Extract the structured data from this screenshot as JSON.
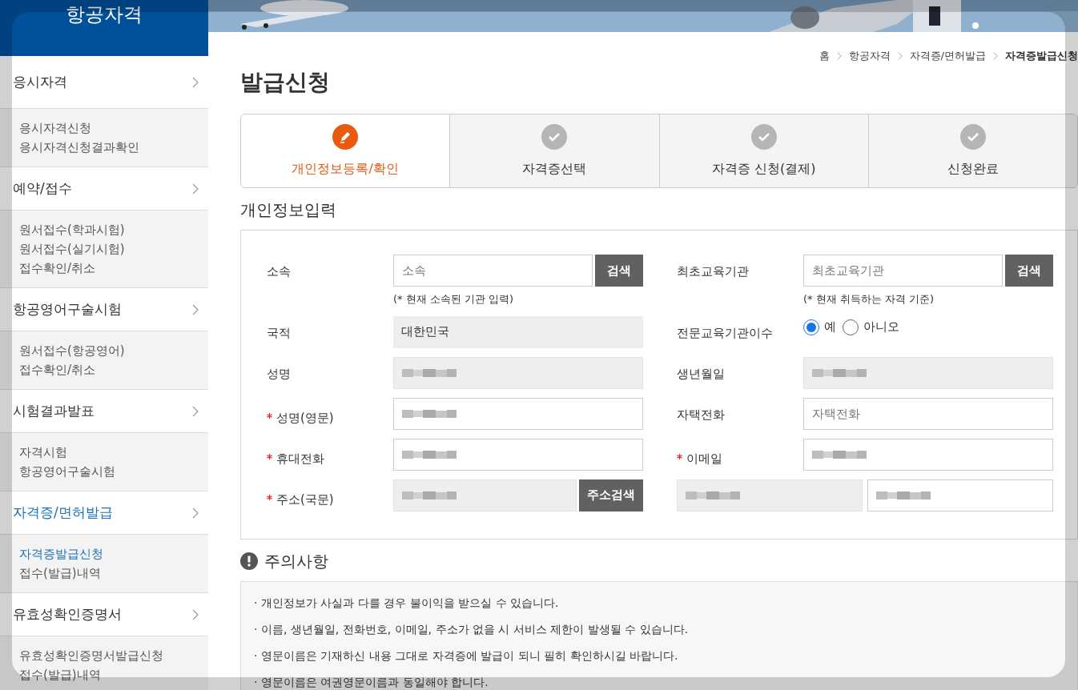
{
  "sidebar": {
    "title": "항공자격",
    "groups": [
      {
        "title": "응시자격",
        "selected": false,
        "items": [
          {
            "label": "응시자격신청",
            "selected": false
          },
          {
            "label": "응시자격신청결과확인",
            "selected": false
          }
        ]
      },
      {
        "title": "예약/접수",
        "selected": false,
        "items": [
          {
            "label": "원서접수(학과시험)",
            "selected": false
          },
          {
            "label": "원서접수(실기시험)",
            "selected": false
          },
          {
            "label": "접수확인/취소",
            "selected": false
          }
        ]
      },
      {
        "title": "항공영어구술시험",
        "selected": false,
        "items": [
          {
            "label": "원서접수(항공영어)",
            "selected": false
          },
          {
            "label": "접수확인/취소",
            "selected": false
          }
        ]
      },
      {
        "title": "시험결과발표",
        "selected": false,
        "items": [
          {
            "label": "자격시험",
            "selected": false
          },
          {
            "label": "항공영어구술시험",
            "selected": false
          }
        ]
      },
      {
        "title": "자격증/면허발급",
        "selected": true,
        "items": [
          {
            "label": "자격증발급신청",
            "selected": true
          },
          {
            "label": "접수(발급)내역",
            "selected": false
          }
        ]
      },
      {
        "title": "유효성확인증명서",
        "selected": false,
        "items": [
          {
            "label": "유효성확인증명서발급신청",
            "selected": false
          },
          {
            "label": "접수(발급)내역",
            "selected": false
          }
        ]
      }
    ]
  },
  "breadcrumb": [
    "홈",
    "항공자격",
    "자격증/면허발급",
    "자격증발급신청"
  ],
  "page_title": "발급신청",
  "steps": [
    {
      "label": "개인정보등록/확인",
      "selected": true
    },
    {
      "label": "자격증선택",
      "selected": false
    },
    {
      "label": "자격증 신청(결제)",
      "selected": false
    },
    {
      "label": "신청완료",
      "selected": false
    }
  ],
  "section_title": "개인정보입력",
  "form_rows": [
    [
      {
        "label": "소속",
        "required": false,
        "controls": [
          {
            "kind": "input",
            "placeholder": "소속"
          },
          {
            "kind": "button",
            "label": "검색"
          }
        ],
        "note": "(* 현재 소속된 기관 입력)"
      },
      {
        "label": "최초교육기관",
        "required": false,
        "controls": [
          {
            "kind": "input",
            "placeholder": "최초교육기관"
          },
          {
            "kind": "button",
            "label": "검색"
          }
        ],
        "note": "(* 현재 취득하는 자격 기준)"
      }
    ],
    [
      {
        "label": "국적",
        "required": false,
        "controls": [
          {
            "kind": "readonly",
            "value": "대한민국"
          }
        ]
      },
      {
        "label": "전문교육기관이수",
        "required": false,
        "controls": [
          {
            "kind": "radio",
            "options": [
              {
                "label": "예",
                "selected": true
              },
              {
                "label": "아니오",
                "selected": false
              }
            ]
          }
        ]
      }
    ],
    [
      {
        "label": "성명",
        "required": false,
        "controls": [
          {
            "kind": "readonly-blurred"
          }
        ]
      },
      {
        "label": "생년월일",
        "required": false,
        "controls": [
          {
            "kind": "readonly-blurred"
          }
        ]
      }
    ],
    [
      {
        "label": "성명(영문)",
        "required": true,
        "controls": [
          {
            "kind": "input-blurred"
          }
        ]
      },
      {
        "label": "자택전화",
        "required": false,
        "controls": [
          {
            "kind": "input",
            "placeholder": "자택전화"
          }
        ]
      }
    ],
    [
      {
        "label": "휴대전화",
        "required": true,
        "controls": [
          {
            "kind": "input-blurred"
          }
        ]
      },
      {
        "label": "이메일",
        "required": true,
        "controls": [
          {
            "kind": "input-blurred"
          }
        ]
      }
    ],
    [
      {
        "label": "주소(국문)",
        "required": true,
        "controls": [
          {
            "kind": "readonly-blurred"
          },
          {
            "kind": "button",
            "label": "주소검색"
          }
        ]
      },
      {
        "controls": [
          {
            "kind": "readonly-blurred"
          },
          {
            "kind": "input-blurred"
          }
        ]
      }
    ]
  ],
  "notice": {
    "title": "주의사항",
    "lines": [
      "· 개인정보가 사실과 다를 경우 불이익을 받으실 수 있습니다.",
      "· 이름, 생년월일, 전화번호, 이메일, 주소가 없을 시 서비스 제한이 발생될 수 있습니다.",
      "· 영문이름은 기재하신 내용 그대로 자격증에 발급이 되니 필히 확인하시길 바랍니다.",
      "· 영문이름은 여권영문이름과 동일해야 합니다."
    ]
  }
}
